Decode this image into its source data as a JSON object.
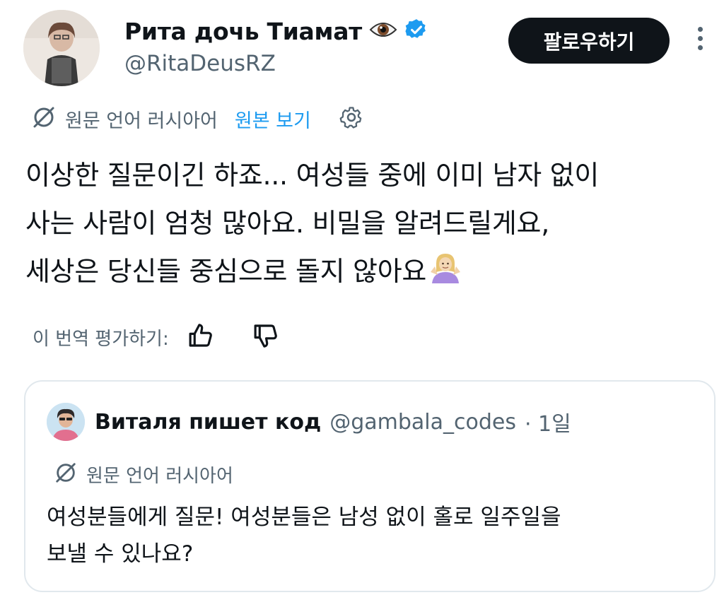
{
  "author": {
    "display_name": "Рита дочь Тиамат",
    "handle": "@RitaDeusRZ",
    "icons": [
      "eye-emoji",
      "verified-badge"
    ]
  },
  "actions": {
    "follow_label": "팔로우하기",
    "more_icon": "more-vertical-icon"
  },
  "translation": {
    "original_language": "원문 언어 러시아어",
    "show_original": "원본 보기",
    "settings_icon": "gear-icon"
  },
  "tweet": {
    "text": "이상한 질문이긴 하죠... 여성들 중에 이미 남자 없이\n사는 사람이 엄청 많아요. 비밀을 알려드릴게요,\n세상은 당신들 중심으로 돌지 않아요",
    "emoji": "person-shrugging"
  },
  "rating": {
    "label": "이 번역 평가하기:",
    "icons": [
      "thumbs-up-icon",
      "thumbs-down-icon"
    ]
  },
  "quote": {
    "display_name": "Виталя пишет код",
    "handle": "@gambala_codes",
    "time": "· 1일",
    "original_language": "원문 언어 러시아어",
    "text": "여성분들에게 질문! 여성분들은 남성 없이 홀로 일주일을\n보낼 수 있나요?"
  },
  "colors": {
    "text": "#0f1419",
    "secondary": "#536471",
    "accent": "#1d9bf0",
    "border": "#e1e8ed"
  }
}
